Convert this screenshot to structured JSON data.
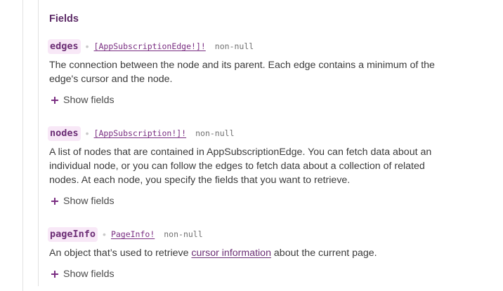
{
  "section": {
    "title": "Fields"
  },
  "fields": [
    {
      "name": "edges",
      "type": "[AppSubscriptionEdge!]!",
      "nullability": "non-null",
      "description": "The connection between the node and its parent. Each edge contains a minimum of the edge's cursor and the node.",
      "show_fields_label": "Show fields"
    },
    {
      "name": "nodes",
      "type": "[AppSubscription!]!",
      "nullability": "non-null",
      "description": "A list of nodes that are contained in AppSubscriptionEdge. You can fetch data about an individual node, or you can follow the edges to fetch data about a collection of related nodes. At each node, you specify the fields that you want to retrieve.",
      "show_fields_label": "Show fields"
    },
    {
      "name": "pageInfo",
      "type": "PageInfo!",
      "nullability": "non-null",
      "description_before": "An object that’s used to retrieve ",
      "description_link": "cursor information",
      "description_after": " about the current page.",
      "show_fields_label": "Show fields"
    }
  ],
  "colors": {
    "accent": "#6b2d74",
    "name_bg": "#f8e8f7",
    "rail": "#e1e1e1"
  },
  "icons": {
    "show_fields": "plus-icon"
  }
}
